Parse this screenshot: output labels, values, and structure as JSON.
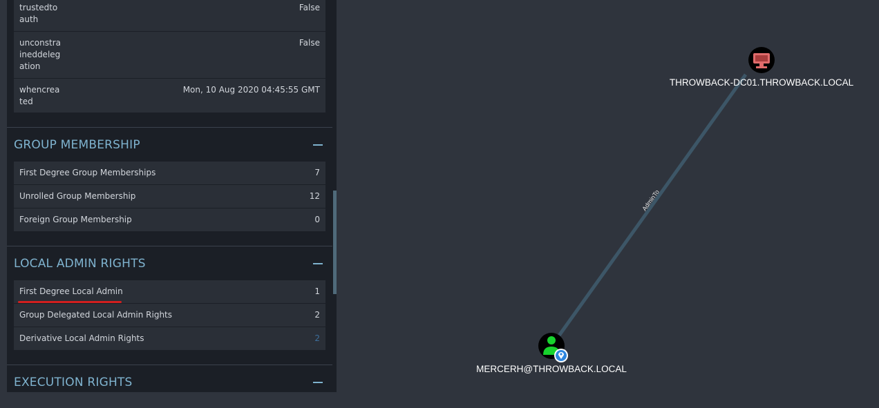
{
  "properties": [
    {
      "label": "trustedtoauth",
      "value": "False"
    },
    {
      "label": "unconstraineddelegation",
      "value": "False"
    },
    {
      "label": "whencreated",
      "value": "Mon, 10 Aug 2020 04:45:55 GMT"
    }
  ],
  "group_membership": {
    "title": "GROUP MEMBERSHIP",
    "rows": [
      {
        "label": "First Degree Group Memberships",
        "value": "7"
      },
      {
        "label": "Unrolled Group Membership",
        "value": "12"
      },
      {
        "label": "Foreign Group Membership",
        "value": "0"
      }
    ]
  },
  "local_admin_rights": {
    "title": "LOCAL ADMIN RIGHTS",
    "rows": [
      {
        "label": "First Degree Local Admin",
        "value": "1"
      },
      {
        "label": "Group Delegated Local Admin Rights",
        "value": "2"
      },
      {
        "label": "Derivative Local Admin Rights",
        "value": "2"
      }
    ]
  },
  "execution_rights": {
    "title": "EXECUTION RIGHTS"
  },
  "graph": {
    "computer_node": {
      "label": "THROWBACK-DC01.THROWBACK.LOCAL",
      "icon": "monitor-icon",
      "color": "#e06b6b"
    },
    "user_node": {
      "label": "MERCERH@THROWBACK.LOCAL",
      "icon": "user-icon",
      "color": "#17d22d"
    },
    "edge": {
      "label": "AdminTo"
    }
  },
  "colors": {
    "section_title": "#7fb3cf",
    "annotation": "#d21f1f",
    "edge": "#3d5667"
  }
}
